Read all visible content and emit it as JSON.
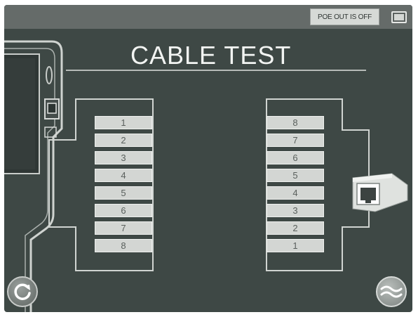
{
  "header": {
    "poe_button_label": "POE OUT IS OFF",
    "battery_icon": "battery-icon"
  },
  "main": {
    "title": "CABLE TEST",
    "left_pins": [
      "1",
      "2",
      "3",
      "4",
      "5",
      "6",
      "7",
      "8"
    ],
    "right_pins": [
      "8",
      "7",
      "6",
      "5",
      "4",
      "3",
      "2",
      "1"
    ]
  },
  "icons": {
    "refresh": "refresh-icon",
    "waveform": "waveform-icon",
    "tester_device": "tester-device-icon",
    "rj45_jack": "rj45-jack-icon"
  },
  "colors": {
    "screen_bg": "#3e4845",
    "topbar_bg": "#656b69",
    "pin_bg": "#d3d6d3",
    "title_text": "#f2f4f2"
  }
}
